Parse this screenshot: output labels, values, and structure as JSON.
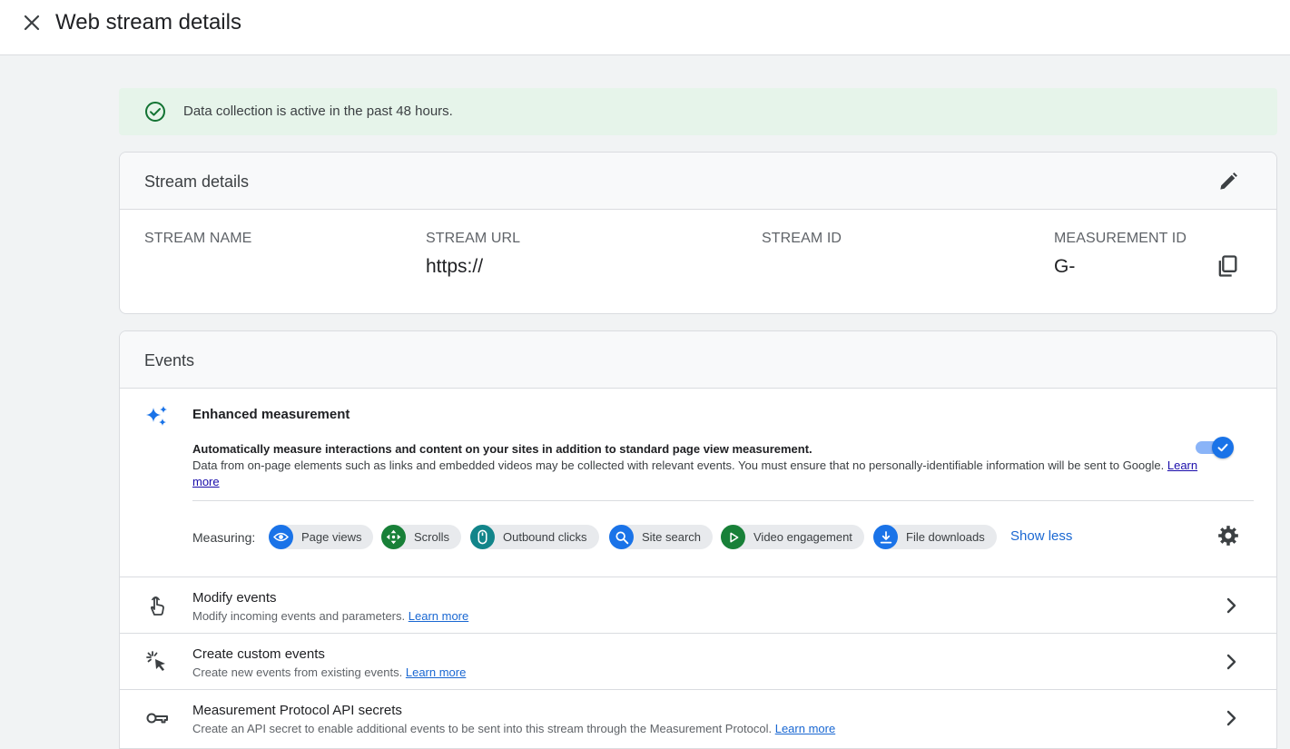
{
  "header": {
    "title": "Web stream details"
  },
  "banner": {
    "message": "Data collection is active in the past 48 hours."
  },
  "stream_details": {
    "title": "Stream details",
    "columns": [
      {
        "label": "STREAM NAME",
        "value": ""
      },
      {
        "label": "STREAM URL",
        "value": "https://"
      },
      {
        "label": "STREAM ID",
        "value": ""
      },
      {
        "label": "MEASUREMENT ID",
        "value": "G-"
      }
    ]
  },
  "events": {
    "title": "Events",
    "enhanced": {
      "title": "Enhanced measurement",
      "desc_bold": "Automatically measure interactions and content on your sites in addition to standard page view measurement.",
      "desc_text": "Data from on-page elements such as links and embedded videos may be collected with relevant events. You must ensure that no personally-identifiable information will be sent to Google.",
      "learn_more": "Learn more",
      "enabled": true
    },
    "measuring_label": "Measuring:",
    "chips": [
      {
        "label": "Page views",
        "icon": "eye-icon",
        "color": "#1a73e8"
      },
      {
        "label": "Scrolls",
        "icon": "scroll-arrows-icon",
        "color": "#188038"
      },
      {
        "label": "Outbound clicks",
        "icon": "mouse-icon",
        "color": "#12858a"
      },
      {
        "label": "Site search",
        "icon": "search-icon",
        "color": "#1a73e8"
      },
      {
        "label": "Video engagement",
        "icon": "play-icon",
        "color": "#188038"
      },
      {
        "label": "File downloads",
        "icon": "download-icon",
        "color": "#1a73e8"
      }
    ],
    "show_less": "Show less",
    "rows": [
      {
        "title": "Modify events",
        "desc": "Modify incoming events and parameters.",
        "link": "Learn more",
        "icon": "touch-hand-icon"
      },
      {
        "title": "Create custom events",
        "desc": "Create new events from existing events.",
        "link": "Learn more",
        "icon": "cursor-click-icon"
      },
      {
        "title": "Measurement Protocol API secrets",
        "desc": "Create an API secret to enable additional events to be sent into this stream through the Measurement Protocol.",
        "link": "Learn more",
        "icon": "key-icon"
      }
    ]
  }
}
